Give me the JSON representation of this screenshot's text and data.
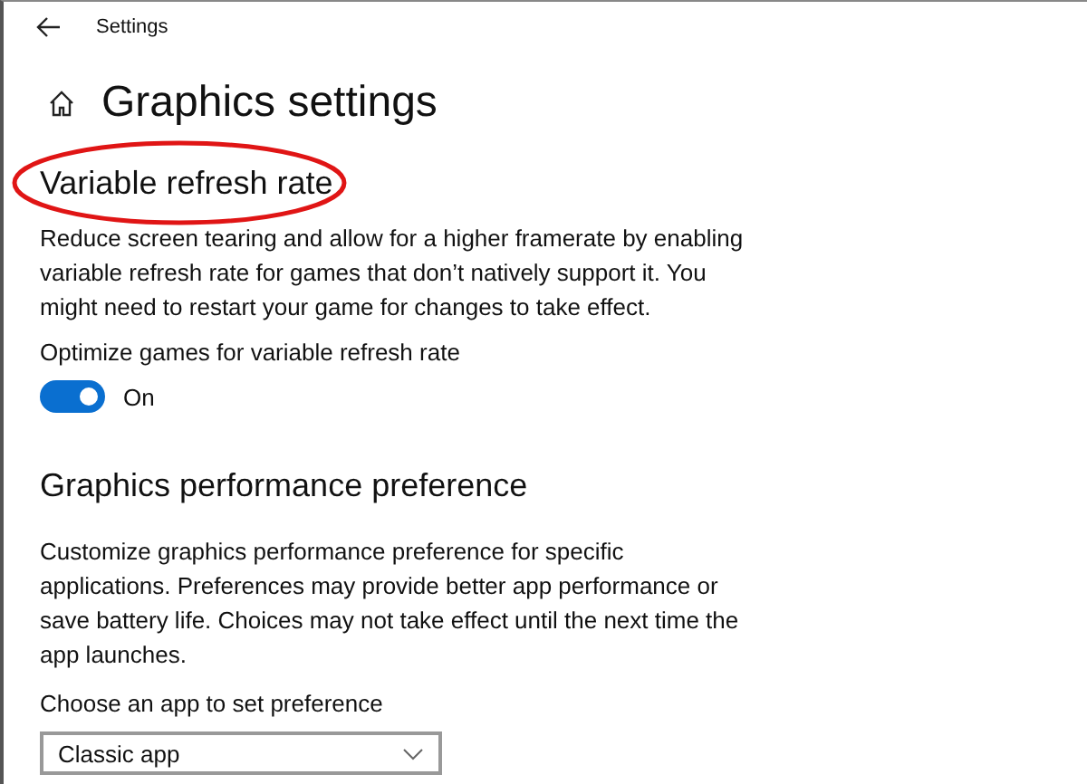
{
  "window": {
    "title": "Settings"
  },
  "page": {
    "title": "Graphics settings"
  },
  "vrr": {
    "heading": "Variable refresh rate",
    "highlighted": true,
    "description": "Reduce screen tearing and allow for a higher framerate by enabling variable refresh rate for games that don’t natively support it. You might need to restart your game for changes to take effect.",
    "toggle": {
      "label": "Optimize games for variable refresh rate",
      "on": true,
      "state_text": "On"
    }
  },
  "performance": {
    "heading": "Graphics performance preference",
    "description": "Customize graphics performance preference for specific applications. Preferences may provide better app performance or save battery life. Choices may not take effect until the next time the app launches.",
    "chooser": {
      "label": "Choose an app to set preference",
      "value": "Classic app"
    }
  }
}
